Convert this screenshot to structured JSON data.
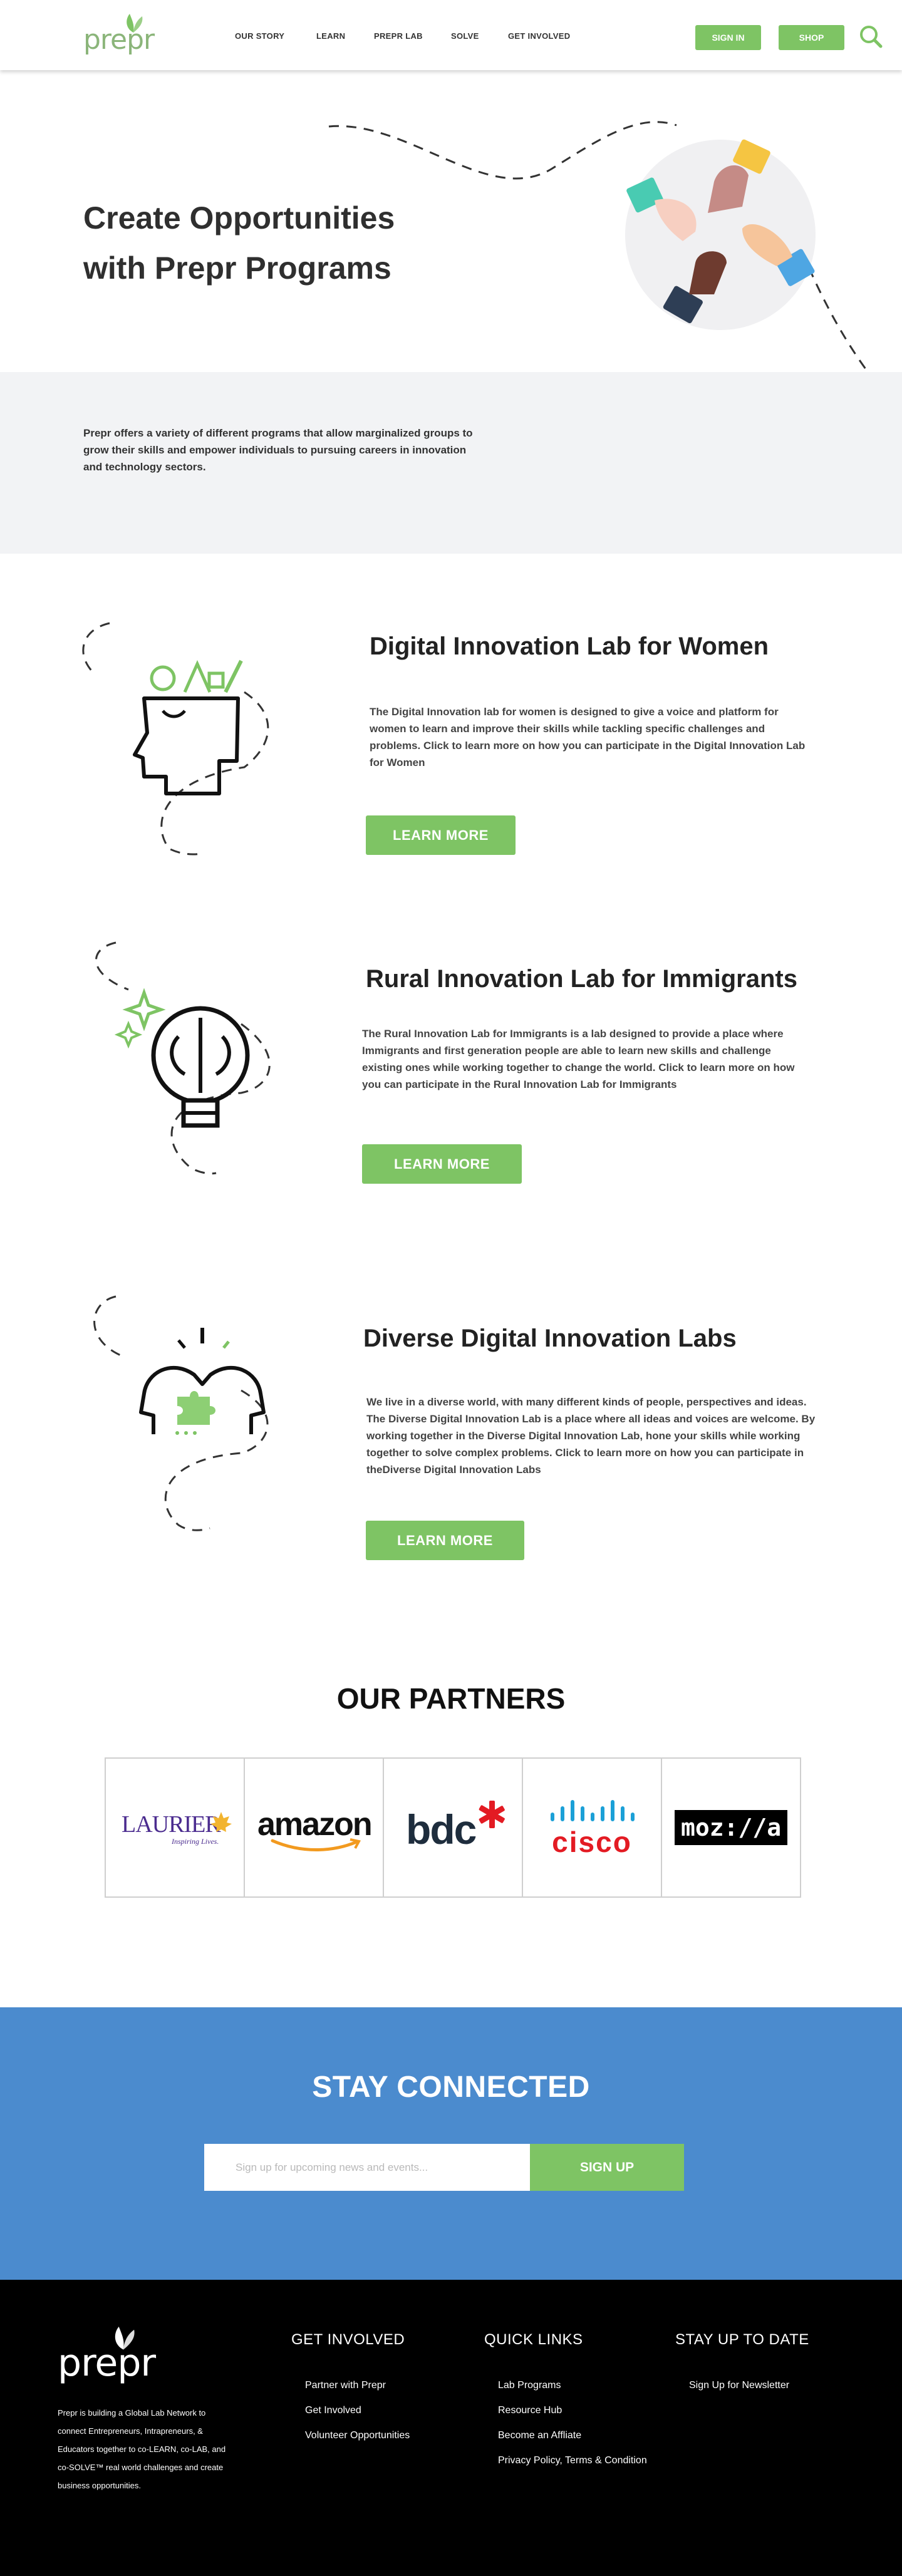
{
  "header": {
    "logo_text": "prepr",
    "nav": [
      "OUR STORY",
      "LEARN",
      "PREPR LAB",
      "SOLVE",
      "GET INVOLVED"
    ],
    "sign_in": "SIGN IN",
    "shop": "SHOP"
  },
  "hero": {
    "title_line1": "Create Opportunities",
    "title_line2": "with  Prepr Programs"
  },
  "intro": {
    "text": "Prepr offers a variety of different programs that allow marginalized groups to grow their skills and empower individuals to pursuing careers in innovation and technology sectors."
  },
  "programs": [
    {
      "title": "Digital Innovation Lab for Women",
      "description": "The Digital Innovation lab for women is designed to give a voice and platform for women to learn and improve their skills while tackling specific challenges and problems. Click to learn more on how you can participate in the Digital Innovation Lab for Women",
      "button": "LEARN MORE"
    },
    {
      "title": "Rural Innovation Lab for Immigrants",
      "description": "The Rural Innovation Lab for Immigrants is a lab designed to provide a place where Immigrants and first generation people are able to learn new skills and challenge existing ones while working together to change the world. Click to learn more on how you can participate in the Rural Innovation Lab for Immigrants",
      "button": "LEARN MORE"
    },
    {
      "title": "Diverse Digital Innovation Labs",
      "description": "We live in a diverse world, with many different kinds of people, perspectives and ideas. The Diverse Digital Innovation Lab is a place where all ideas and voices are welcome. By working together in the Diverse Digital Innovation Lab, hone your skills while working together to solve complex problems. Click to learn more on how you can participate in theDiverse Digital Innovation Labs",
      "button": "LEARN MORE"
    }
  ],
  "partners": {
    "title": "OUR PARTNERS",
    "logos": [
      "LAURIER",
      "Inspiring Lives.",
      "amazon",
      "bdc",
      "cisco",
      "moz://a"
    ]
  },
  "stay": {
    "title": "STAY CONNECTED",
    "placeholder": "Sign up for upcoming news and events...",
    "button": "SIGN UP"
  },
  "footer": {
    "logo_text": "prepr",
    "about": "Prepr is building a Global Lab Network to connect Entrepreneurs, Intrapreneurs, & Educators together to co-LEARN, co-LAB, and co-SOLVE™ real world challenges and create business opportunities.",
    "col1": {
      "heading": "GET INVOLVED",
      "links": [
        "Partner with Prepr",
        "Get Involved",
        "Volunteer Opportunities"
      ]
    },
    "col2": {
      "heading": "QUICK LINKS",
      "links": [
        "Lab Programs",
        "Resource Hub",
        "Become an Affliate",
        "Privacy Policy, Terms & Condition"
      ]
    },
    "col3": {
      "heading": "STAY UP TO DATE",
      "links": [
        "Sign Up for Newsletter"
      ]
    }
  },
  "colors": {
    "green": "#7ec464",
    "blue": "#4b8bce",
    "footer": "#000000",
    "band": "#f2f3f5"
  }
}
